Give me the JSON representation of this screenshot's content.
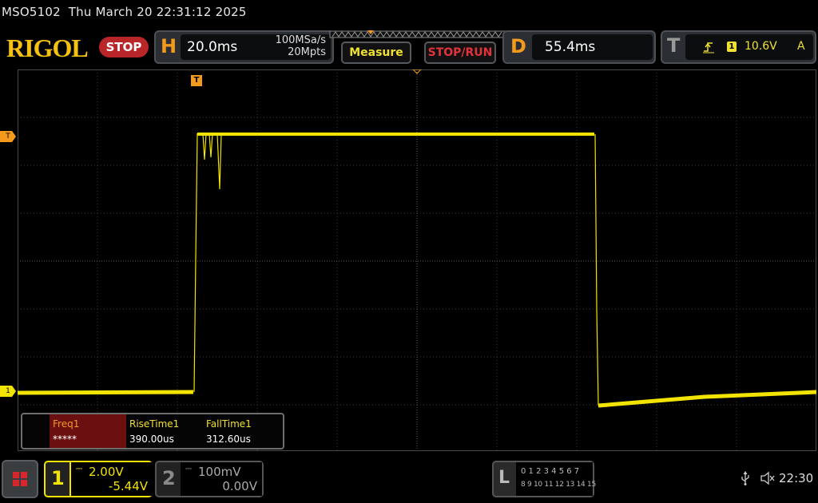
{
  "header": {
    "model": "MSO5102",
    "datetime": "Thu March 20 22:31:12 2025",
    "brand": "RIGOL",
    "run_state": "STOP"
  },
  "horizontal": {
    "letter": "H",
    "timebase": "20.0ms",
    "sample_rate": "100MSa/s",
    "memory_depth": "20Mpts"
  },
  "buttons": {
    "measure": "Measure",
    "stop_run": "STOP/RUN"
  },
  "delay": {
    "letter": "D",
    "value": "55.4ms"
  },
  "trigger": {
    "letter": "T",
    "edge_icon": "rising-edge-icon",
    "source": "1",
    "level": "10.6V",
    "mode": "A"
  },
  "markers": {
    "trigger_position": "T",
    "trigger_level": "T",
    "ch1_ground": "1"
  },
  "measurements": {
    "columns": [
      {
        "name": "Freq1",
        "value": "*****"
      },
      {
        "name": "RiseTime1",
        "value": "390.00us"
      },
      {
        "name": "FallTime1",
        "value": "312.60us"
      }
    ]
  },
  "channels": {
    "ch1": {
      "number": "1",
      "scale": "2.00V",
      "offset": "-5.44V",
      "color": "#f2e400"
    },
    "ch2": {
      "number": "2",
      "scale": "100mV",
      "offset": "0.00V",
      "color": "#8a8a8a"
    }
  },
  "logic": {
    "letter": "L",
    "row1": "0 1 2 3  4 5 6 7",
    "row2": "8 9 10 11 12 13 14 15"
  },
  "status": {
    "usb_icon": "usb-icon",
    "sound_icon": "speaker-muted-icon",
    "time": "22:30"
  },
  "colors": {
    "waveform": "#f2e400",
    "accent_orange": "#f39a1d",
    "stop_red": "#b9262a"
  }
}
